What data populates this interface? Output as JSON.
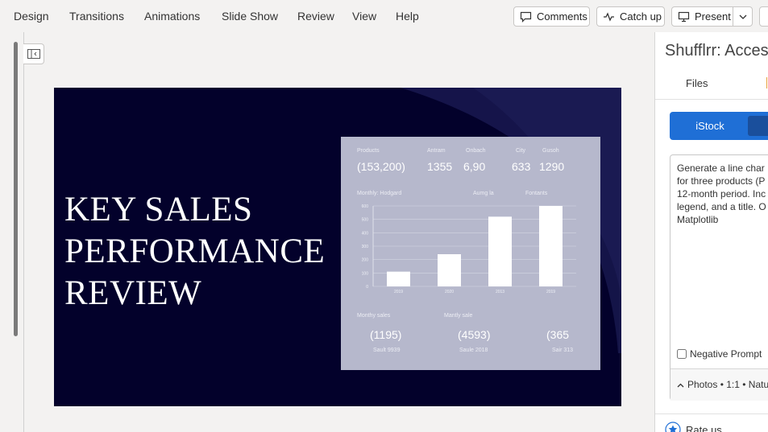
{
  "ribbon": {
    "menu": [
      "Design",
      "Transitions",
      "Animations",
      "Slide Show",
      "Review",
      "View",
      "Help"
    ],
    "comments_label": "Comments",
    "catchup_label": "Catch up",
    "present_label": "Present"
  },
  "slide": {
    "title_lines": [
      "KEY SALES",
      "PERFORMANCE",
      "REVIEW"
    ],
    "dashboard": {
      "top_labels": [
        "Products",
        "Antram",
        "Onbach",
        "City",
        "Gusoh"
      ],
      "top_values": [
        "(153,200)",
        "1355",
        "6,90",
        "633",
        "1290"
      ],
      "section_labels": [
        "Monthly: Hodgard",
        "Aumg la",
        "Fontants"
      ],
      "y_ticks": [
        "600",
        "500",
        "400",
        "300",
        "200",
        "100",
        "0"
      ],
      "bar_labels": [
        "2019",
        "2020",
        "2013",
        "2019"
      ],
      "bottom_labels": [
        "Monthy sales",
        "Mantly sale"
      ],
      "gauge_values": [
        "1195",
        "4593",
        "365"
      ],
      "gauge_captions": [
        "Sault 9939",
        "Saule 2018",
        "Sair 313"
      ]
    }
  },
  "chart_data": {
    "type": "bar",
    "categories": [
      "2019",
      "2020",
      "2013",
      "2019"
    ],
    "values": [
      110,
      240,
      520,
      600
    ],
    "ylim": [
      0,
      600
    ],
    "title": "Monthly: Hodgard",
    "xlabel": "",
    "ylabel": "",
    "grid": true,
    "bar_color": "#ffffff"
  },
  "pane": {
    "title": "Shufflrr: Access",
    "tab_files": "Files",
    "segment_label": "iStock",
    "prompt_lines": [
      "Generate a line char",
      "for three products (P",
      "12-month period. Inc",
      "legend, and a title. O",
      "Matplotlib"
    ],
    "negative_prompt_label": "Negative Prompt",
    "options_label": "Photos • 1:1 • Natu",
    "rate_label": "Rate us"
  }
}
